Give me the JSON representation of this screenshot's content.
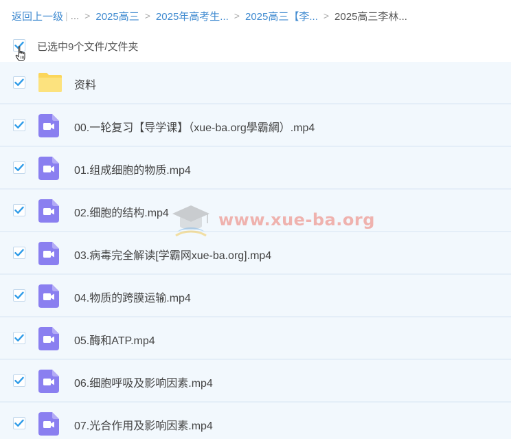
{
  "breadcrumb": {
    "back": "返回上一级",
    "ellipsis": "...",
    "items": [
      "2025高三",
      "2025年高考生...",
      "2025高三【李...",
      "2025高三李林..."
    ]
  },
  "selection": {
    "text": "已选中9个文件/文件夹",
    "all_checked": true
  },
  "files": [
    {
      "name": "资料",
      "type": "folder",
      "checked": true
    },
    {
      "name": "00.一轮复习【导学课】（xue-ba.org學霸網）.mp4",
      "type": "video",
      "checked": true
    },
    {
      "name": "01.组成细胞的物质.mp4",
      "type": "video",
      "checked": true
    },
    {
      "name": "02.细胞的结构.mp4",
      "type": "video",
      "checked": true
    },
    {
      "name": "03.病毒完全解读[学霸网xue-ba.org].mp4",
      "type": "video",
      "checked": true
    },
    {
      "name": "04.物质的跨膜运输.mp4",
      "type": "video",
      "checked": true
    },
    {
      "name": "05.酶和ATP.mp4",
      "type": "video",
      "checked": true
    },
    {
      "name": "06.细胞呼吸及影响因素.mp4",
      "type": "video",
      "checked": true
    },
    {
      "name": "07.光合作用及影响因素.mp4",
      "type": "video",
      "checked": true
    }
  ],
  "watermark": "www.xue-ba.org",
  "colors": {
    "link": "#3f8ad0",
    "check": "#2d9be8",
    "video_icon": "#8a7ff0",
    "folder": "#fbd65b",
    "row_bg": "#f2f8fd"
  },
  "icons": {
    "folder": "folder-icon",
    "video": "video-file-icon",
    "check": "check-icon",
    "cursor": "hand-cursor-icon",
    "watermark_logo": "graduation-cap-icon"
  }
}
